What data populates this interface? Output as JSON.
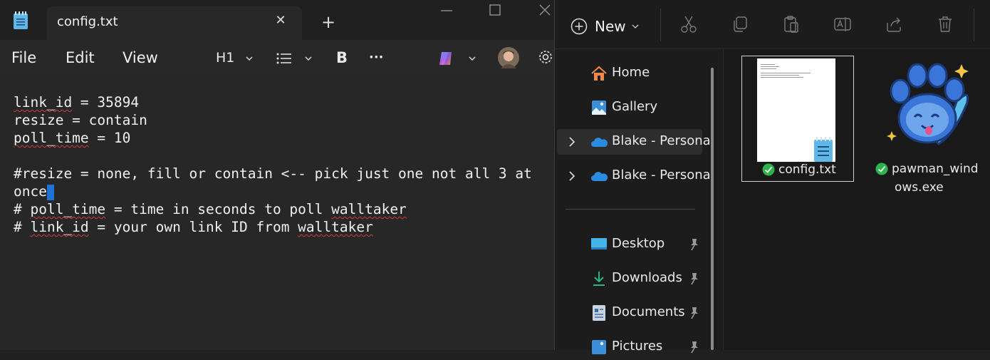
{
  "notepad": {
    "tab_title": "config.txt",
    "menu": {
      "file": "File",
      "edit": "Edit",
      "view": "View"
    },
    "toolbar": {
      "heading": "H1",
      "bold": "B",
      "more": "···"
    },
    "lines": [
      {
        "parts": [
          {
            "t": "link_id",
            "sq": true
          },
          {
            "t": " = 35894"
          }
        ]
      },
      {
        "parts": [
          {
            "t": "resize = contain"
          }
        ]
      },
      {
        "parts": [
          {
            "t": "poll_time",
            "sq": true
          },
          {
            "t": " = 10"
          }
        ]
      },
      {
        "parts": [
          {
            "t": ""
          }
        ]
      },
      {
        "parts": [
          {
            "t": "#resize = none, fill or contain <-- pick just one not all 3 at"
          }
        ]
      },
      {
        "parts": [
          {
            "t": "once"
          }
        ],
        "caret": true
      },
      {
        "parts": [
          {
            "t": "# "
          },
          {
            "t": "poll_time",
            "sq": true
          },
          {
            "t": " = time in seconds to poll "
          },
          {
            "t": "walltaker",
            "sq": true
          }
        ]
      },
      {
        "parts": [
          {
            "t": "# "
          },
          {
            "t": "link_id",
            "sq": true
          },
          {
            "t": " = your own link ID from "
          },
          {
            "t": "walltaker",
            "sq": true
          }
        ]
      }
    ]
  },
  "explorer": {
    "new_label": "New",
    "nav": [
      {
        "label": "Home",
        "icon": "home-icon"
      },
      {
        "label": "Gallery",
        "icon": "gallery-icon"
      },
      {
        "label": "Blake - Personal",
        "icon": "onedrive-icon",
        "expandable": true,
        "selected": true
      },
      {
        "label": "Blake - Personal",
        "icon": "onedrive-icon",
        "expandable": true
      },
      {
        "label": "Desktop",
        "icon": "desktop-icon",
        "pinned": true
      },
      {
        "label": "Downloads",
        "icon": "downloads-icon",
        "pinned": true
      },
      {
        "label": "Documents",
        "icon": "documents-icon",
        "pinned": true
      },
      {
        "label": "Pictures",
        "icon": "pictures-icon",
        "pinned": true
      }
    ],
    "files": [
      {
        "name": "config.txt",
        "status": "synced"
      },
      {
        "name_line1": "pawman_wind",
        "name_line2": "ows.exe",
        "status": "synced"
      }
    ]
  },
  "colors": {
    "accent": "#1f73d6",
    "sync_green": "#2bb44a",
    "squiggle": "#d23c3c"
  }
}
